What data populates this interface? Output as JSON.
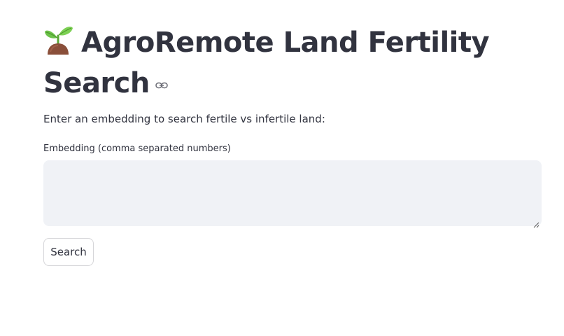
{
  "header": {
    "icon": "seedling-icon",
    "title": "AgroRemote Land Fertility Search",
    "anchor_icon": "link-icon"
  },
  "main": {
    "subtitle": "Enter an embedding to search fertile vs infertile land:",
    "embedding_field": {
      "label": "Embedding (comma separated numbers)",
      "value": "",
      "placeholder": ""
    },
    "search_button": {
      "label": "Search"
    }
  },
  "colors": {
    "text": "#31333f",
    "input_bg": "#f0f2f6",
    "button_border": "#d6d6d9",
    "leaf_green": "#5fb83a",
    "soil_brown": "#8a4f3a"
  }
}
